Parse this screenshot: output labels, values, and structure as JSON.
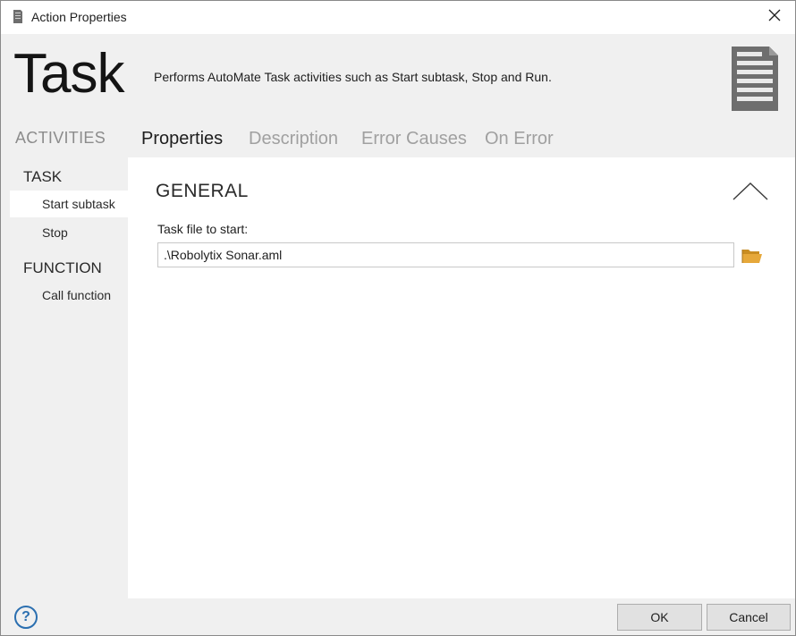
{
  "window": {
    "title": "Action Properties",
    "app_icon": "document-icon",
    "close_icon": "close-icon"
  },
  "header": {
    "title": "Task",
    "description": "Performs AutoMate Task activities such as Start subtask, Stop and Run.",
    "icon": "notepad-icon"
  },
  "sidebar": {
    "heading": "ACTIVITIES",
    "groups": [
      {
        "title": "TASK",
        "items": [
          {
            "label": "Start subtask",
            "selected": true
          },
          {
            "label": "Stop",
            "selected": false
          }
        ]
      },
      {
        "title": "FUNCTION",
        "items": [
          {
            "label": "Call function",
            "selected": false
          }
        ]
      }
    ]
  },
  "tabs": [
    {
      "label": "Properties",
      "active": true
    },
    {
      "label": "Description",
      "active": false
    },
    {
      "label": "Error Causes",
      "active": false
    },
    {
      "label": "On Error",
      "active": false
    }
  ],
  "general": {
    "section_title": "GENERAL",
    "collapse_icon": "chevron-up-icon",
    "task_file_label": "Task file to start:",
    "task_file_value": ".\\Robolytix Sonar.aml",
    "browse_icon": "folder-icon"
  },
  "footer": {
    "help_label": "?",
    "ok_label": "OK",
    "cancel_label": "Cancel"
  },
  "colors": {
    "accent": "#2b6fb0",
    "folder": "#e6a83a",
    "window_bg": "#f0f0f0",
    "panel_bg": "#ffffff"
  }
}
